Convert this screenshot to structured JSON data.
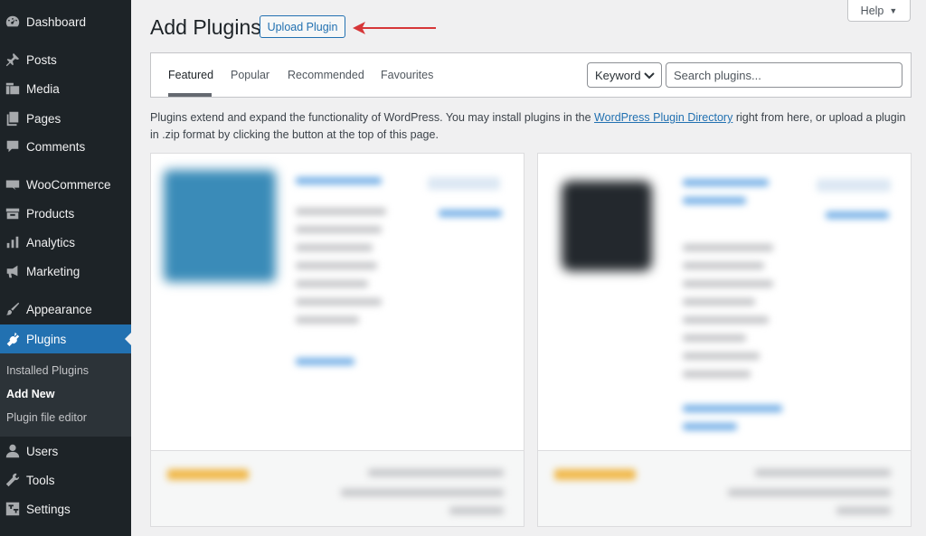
{
  "sidebar": {
    "items": [
      {
        "label": "Dashboard",
        "icon": "dashboard-icon"
      },
      {
        "label": "Posts",
        "icon": "pin-icon"
      },
      {
        "label": "Media",
        "icon": "media-icon"
      },
      {
        "label": "Pages",
        "icon": "pages-icon"
      },
      {
        "label": "Comments",
        "icon": "comments-icon"
      },
      {
        "label": "WooCommerce",
        "icon": "woocommerce-icon"
      },
      {
        "label": "Products",
        "icon": "products-icon"
      },
      {
        "label": "Analytics",
        "icon": "analytics-icon"
      },
      {
        "label": "Marketing",
        "icon": "megaphone-icon"
      },
      {
        "label": "Appearance",
        "icon": "brush-icon"
      },
      {
        "label": "Plugins",
        "icon": "plugin-icon"
      },
      {
        "label": "Users",
        "icon": "users-icon"
      },
      {
        "label": "Tools",
        "icon": "wrench-icon"
      },
      {
        "label": "Settings",
        "icon": "settings-icon"
      }
    ],
    "active": "Plugins",
    "submenu": [
      "Installed Plugins",
      "Add New",
      "Plugin file editor"
    ],
    "submenu_current": "Add New"
  },
  "header": {
    "title": "Add Plugins",
    "upload_button": "Upload Plugin",
    "help": "Help"
  },
  "filter": {
    "tabs": [
      "Featured",
      "Popular",
      "Recommended",
      "Favourites"
    ],
    "current_tab": "Featured",
    "search_type": "Keyword",
    "search_placeholder": "Search plugins..."
  },
  "description": {
    "before_link": "Plugins extend and expand the functionality of WordPress. You may install plugins in the ",
    "link": "WordPress Plugin Directory",
    "after_link": " right from here, or upload a plugin in .zip format by clicking the button at the top of this page."
  },
  "colors": {
    "sidebar_bg": "#1d2327",
    "accent": "#2271b1",
    "arrow": "#d63638"
  }
}
